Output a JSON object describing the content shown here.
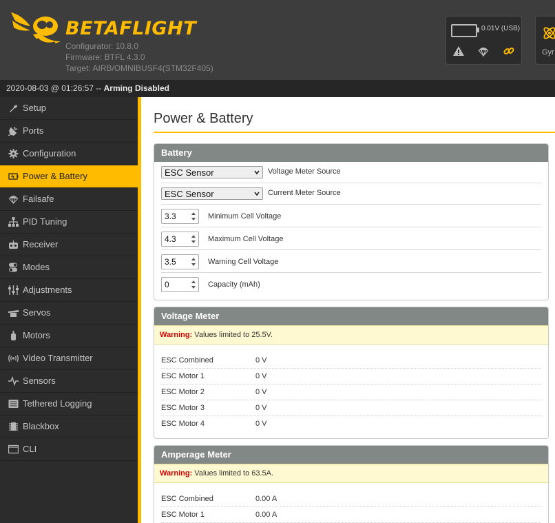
{
  "header": {
    "brand": "BETAFLIGHT",
    "configurator": "Configurator: 10.8.0",
    "firmware": "Firmware: BTFL 4.3.0",
    "target": "Target: AIRB/OMNIBUSF4(STM32F405)",
    "battery_text": "0.01V (USB)",
    "gyro_label": "Gyr"
  },
  "statusbar": {
    "timestamp": "2020-08-03 @ 01:26:57 -- ",
    "arming": "Arming Disabled"
  },
  "sidebar": {
    "items": [
      {
        "label": "Setup",
        "icon": "wrench-icon"
      },
      {
        "label": "Ports",
        "icon": "plug-icon"
      },
      {
        "label": "Configuration",
        "icon": "gear-icon"
      },
      {
        "label": "Power & Battery",
        "icon": "battery-icon",
        "active": true
      },
      {
        "label": "Failsafe",
        "icon": "parachute-icon"
      },
      {
        "label": "PID Tuning",
        "icon": "pid-icon"
      },
      {
        "label": "Receiver",
        "icon": "receiver-icon"
      },
      {
        "label": "Modes",
        "icon": "toggle-icon"
      },
      {
        "label": "Adjustments",
        "icon": "sliders-icon"
      },
      {
        "label": "Servos",
        "icon": "servo-icon"
      },
      {
        "label": "Motors",
        "icon": "motor-icon"
      },
      {
        "label": "Video Transmitter",
        "icon": "antenna-icon"
      },
      {
        "label": "Sensors",
        "icon": "pulse-icon"
      },
      {
        "label": "Tethered Logging",
        "icon": "logging-icon"
      },
      {
        "label": "Blackbox",
        "icon": "chip-icon"
      },
      {
        "label": "CLI",
        "icon": "terminal-icon"
      }
    ]
  },
  "main": {
    "title": "Power & Battery",
    "battery": {
      "heading": "Battery",
      "voltage_source": {
        "value": "ESC Sensor",
        "label": "Voltage Meter Source"
      },
      "current_source": {
        "value": "ESC Sensor",
        "label": "Current Meter Source"
      },
      "min_cell": {
        "value": "3.3",
        "label": "Minimum Cell Voltage"
      },
      "max_cell": {
        "value": "4.3",
        "label": "Maximum Cell Voltage"
      },
      "warn_cell": {
        "value": "3.5",
        "label": "Warning Cell Voltage"
      },
      "capacity": {
        "value": "0",
        "label": "Capacity (mAh)"
      }
    },
    "voltage_meter": {
      "heading": "Voltage Meter",
      "warning_label": "Warning:",
      "warning_text": " Values limited to 25.5V.",
      "rows": [
        {
          "label": "ESC Combined",
          "value": "0 V"
        },
        {
          "label": "ESC Motor 1",
          "value": "0 V"
        },
        {
          "label": "ESC Motor 2",
          "value": "0 V"
        },
        {
          "label": "ESC Motor 3",
          "value": "0 V"
        },
        {
          "label": "ESC Motor 4",
          "value": "0 V"
        }
      ]
    },
    "amperage_meter": {
      "heading": "Amperage Meter",
      "warning_label": "Warning:",
      "warning_text": " Values limited to 63.5A.",
      "rows": [
        {
          "label": "ESC Combined",
          "value": "0.00 A"
        },
        {
          "label": "ESC Motor 1",
          "value": "0.00 A"
        }
      ]
    }
  },
  "colors": {
    "accent": "#ffbb00",
    "panel_header": "#828885",
    "warning_red": "#d40000"
  }
}
